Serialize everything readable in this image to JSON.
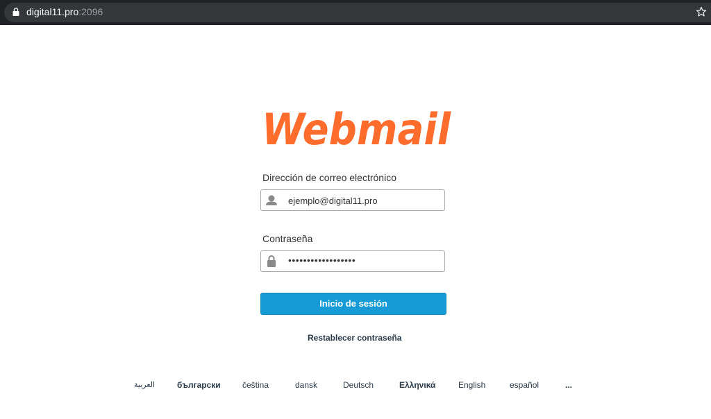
{
  "browser": {
    "host": "digital11.pro",
    "port": ":2096"
  },
  "brand": {
    "logo_text": "Webmail",
    "color": "#ff6c2c"
  },
  "form": {
    "email_label": "Dirección de correo electrónico",
    "email_value": "ejemplo@digital11.pro",
    "password_label": "Contraseña",
    "password_mask": "••••••••••••••••••",
    "submit_label": "Inicio de sesión",
    "reset_label": "Restablecer contraseña",
    "button_color": "#179bd7"
  },
  "languages": [
    "العربية",
    "български",
    "čeština",
    "dansk",
    "Deutsch",
    "Ελληνικά",
    "English",
    "español",
    "..."
  ]
}
